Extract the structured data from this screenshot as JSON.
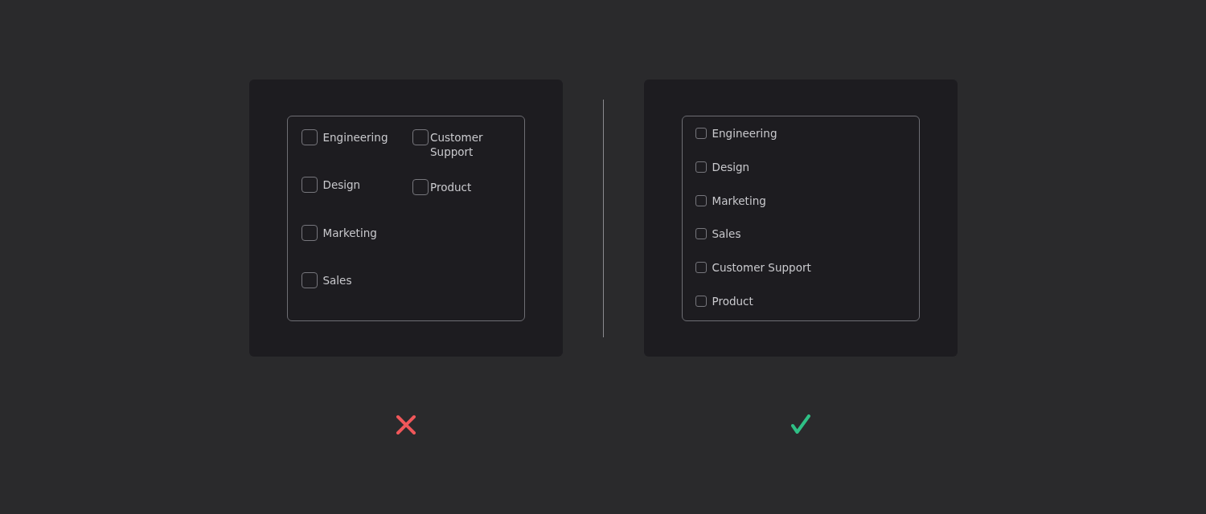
{
  "examples": [
    {
      "kind": "dont",
      "columns": [
        [
          {
            "label": "Engineering",
            "checked": false
          },
          {
            "label": "Design",
            "checked": false
          },
          {
            "label": "Marketing",
            "checked": false
          },
          {
            "label": "Sales",
            "checked": false
          }
        ],
        [
          {
            "label": "Customer Support",
            "checked": false
          },
          {
            "label": "Product",
            "checked": false
          }
        ]
      ]
    },
    {
      "kind": "do",
      "columns": [
        [
          {
            "label": "Engineering",
            "checked": false
          },
          {
            "label": "Design",
            "checked": false
          },
          {
            "label": "Marketing",
            "checked": false
          },
          {
            "label": "Sales",
            "checked": false
          },
          {
            "label": "Customer Support",
            "checked": false
          },
          {
            "label": "Product",
            "checked": false
          }
        ]
      ]
    }
  ]
}
